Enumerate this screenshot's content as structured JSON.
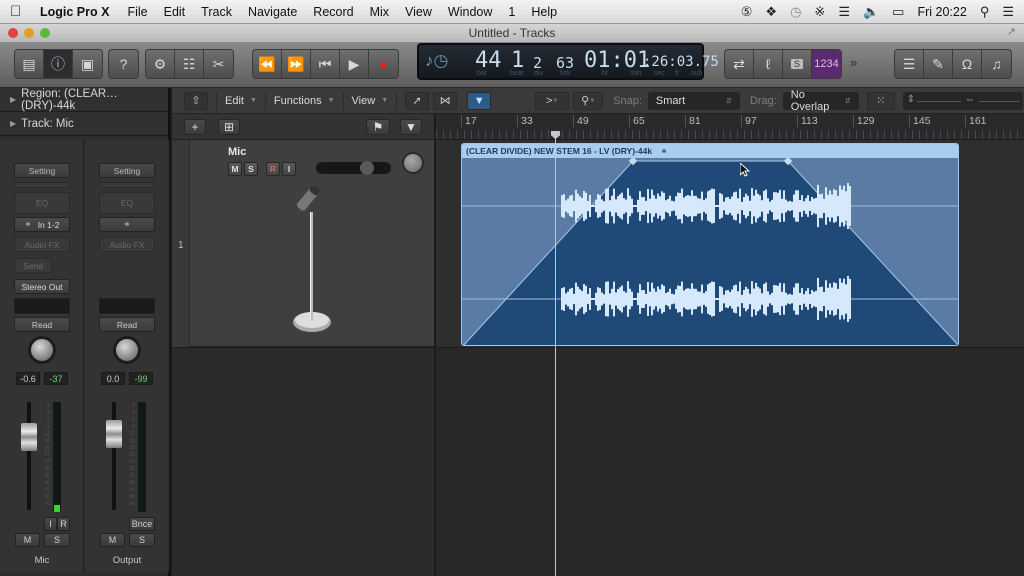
{
  "menubar": {
    "apple_icon": "",
    "app_name": "Logic Pro X",
    "items": [
      "File",
      "Edit",
      "Track",
      "Navigate",
      "Record",
      "Mix",
      "View",
      "Window",
      "1",
      "Help"
    ],
    "status_icons": [
      "shield-5-icon",
      "dropbox-icon",
      "time-machine-icon",
      "bluetooth-icon",
      "wifi-icon",
      "volume-icon",
      "battery-icon"
    ],
    "clock": "Fri 20:22",
    "spotlight_icon": "search-icon",
    "notification_icon": "list-icon"
  },
  "window": {
    "title": "Untitled - Tracks"
  },
  "toolbar": {
    "left_group": [
      "library-icon",
      "inspector-icon",
      "toolbar-icon"
    ],
    "help_icon": "?",
    "edit_group": [
      "smart-controls-icon",
      "mixer-icon",
      "editors-icon"
    ],
    "transport": [
      "rewind-icon",
      "fast-forward-icon",
      "go-to-start-icon",
      "play-icon",
      "record-icon"
    ],
    "right_group": [
      "cycle-icon",
      "tuner-icon",
      "solo-icon",
      "count-in-1234"
    ],
    "count_in_label": "1234",
    "solo_label": "S",
    "more_icon": "»",
    "view_group": [
      "list-editors-icon",
      "note-pad-icon",
      "loop-browser-icon",
      "media-browser-icon"
    ]
  },
  "lcd": {
    "bar": "44",
    "beat": "1",
    "div": "2",
    "tick": "63",
    "time_hr_min": "01:01",
    "time_rest": ":26:03.75",
    "labels": {
      "bar": "bar",
      "beat": "beat",
      "div": "div",
      "tick": "tick",
      "hr": "hr",
      "min": "min",
      "sec": "sec",
      "fr": "fr",
      "sub": "sub"
    }
  },
  "inspector": {
    "region_label": "Region: (CLEAR…(DRY)-44k",
    "track_label": "Track:  Mic",
    "strips": [
      {
        "name": "Mic",
        "setting": "Setting",
        "eq": "EQ",
        "input": "In 1-2",
        "audio_fx": "Audio FX",
        "send": "Send",
        "output": "Stereo Out",
        "automation": "Read",
        "volume": "-0.6",
        "peak": "-37",
        "buttons": [
          "I",
          "R"
        ],
        "mute": "M",
        "solo": "S"
      },
      {
        "name": "Output",
        "setting": "Setting",
        "eq": "EQ",
        "audio_fx": "Audio FX",
        "automation": "Read",
        "volume": "0.0",
        "peak": "-99",
        "bounce": "Bnce",
        "mute": "M",
        "solo": "S"
      }
    ],
    "meter_scale": [
      "0",
      "3",
      "6",
      "9",
      "12",
      "15",
      "18",
      "21",
      "24",
      "30",
      "35",
      "40",
      "45",
      "50",
      "60"
    ]
  },
  "tracks_toolbar": {
    "edit": "Edit",
    "functions": "Functions",
    "view": "View",
    "snap_label": "Snap:",
    "snap_value": "Smart",
    "drag_label": "Drag:",
    "drag_value": "No Overlap"
  },
  "ruler": {
    "bars": [
      "17",
      "33",
      "49",
      "65",
      "81",
      "97",
      "113",
      "129",
      "145",
      "161"
    ]
  },
  "track": {
    "number": "1",
    "name": "Mic",
    "buttons": [
      "M",
      "S",
      "R",
      "I"
    ],
    "volume_fraction": 0.72
  },
  "region": {
    "title": "(CLEAR DIVIDE) NEW STEM 16 - LV (DRY)-44k",
    "stereo_icon": "stereo-link-icon"
  }
}
